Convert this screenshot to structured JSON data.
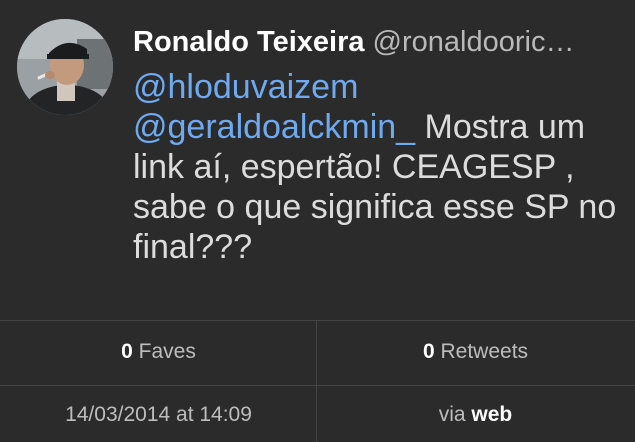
{
  "tweet": {
    "author_name": "Ronaldo Teixeira",
    "author_handle": "@ronaldooric…",
    "mention_1": "@hloduvaizem",
    "mention_2": "@geraldoalckmin_",
    "text_after_mentions": " Mostra um link aí, espertão! CEAGESP , sabe o que significa esse SP no final???"
  },
  "stats": {
    "faves_count": "0",
    "faves_label": " Faves",
    "retweets_count": "0",
    "retweets_label": " Retweets"
  },
  "meta": {
    "timestamp": "14/03/2014 at 14:09",
    "via_prefix": "via ",
    "source": "web"
  },
  "colors": {
    "background": "#2b2b2b",
    "mention": "#6fa9ef",
    "divider": "#454545"
  },
  "icons": {
    "avatar": "profile-photo"
  }
}
